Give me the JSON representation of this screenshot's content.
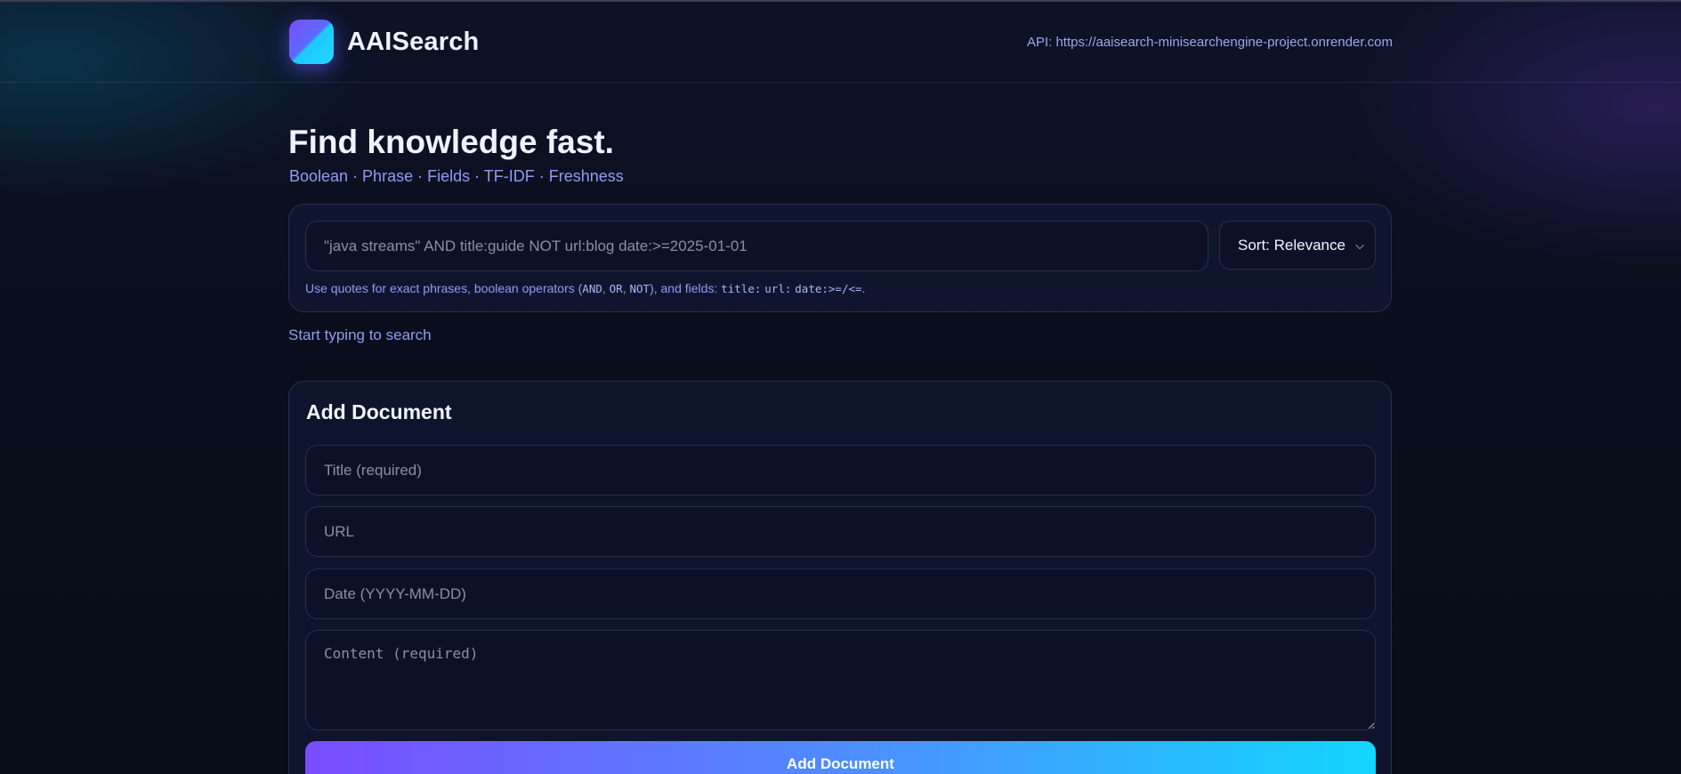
{
  "header": {
    "brand_name": "AAISearch",
    "api_label": "API: https://aaisearch-minisearchengine-project.onrender.com"
  },
  "hero": {
    "title": "Find knowledge fast.",
    "subtitle": "Boolean · Phrase · Fields · TF-IDF · Freshness"
  },
  "search": {
    "placeholder": "\"java streams\" AND title:guide NOT url:blog date:>=2025-01-01",
    "value": "",
    "sort_selected": "Sort: Relevance",
    "hint": {
      "prefix": "Use quotes for exact phrases, boolean operators (",
      "op_and": "AND",
      "sep1": ", ",
      "op_or": "OR",
      "sep2": ", ",
      "op_not": "NOT",
      "middle": "), and fields: ",
      "field_title": "title:",
      "field_url": "url:",
      "field_date": "date:>=/<=",
      "suffix": "."
    }
  },
  "status_text": "Start typing to search",
  "add_document": {
    "title": "Add Document",
    "title_placeholder": "Title (required)",
    "url_placeholder": "URL",
    "date_placeholder": "Date (YYYY-MM-DD)",
    "content_placeholder": "Content (required)",
    "submit_label": "Add Document"
  },
  "colors": {
    "background": "#0a0e1c",
    "accent_purple": "#7a4dff",
    "accent_cyan": "#12d6ff",
    "muted_text": "#8e9cf2"
  }
}
